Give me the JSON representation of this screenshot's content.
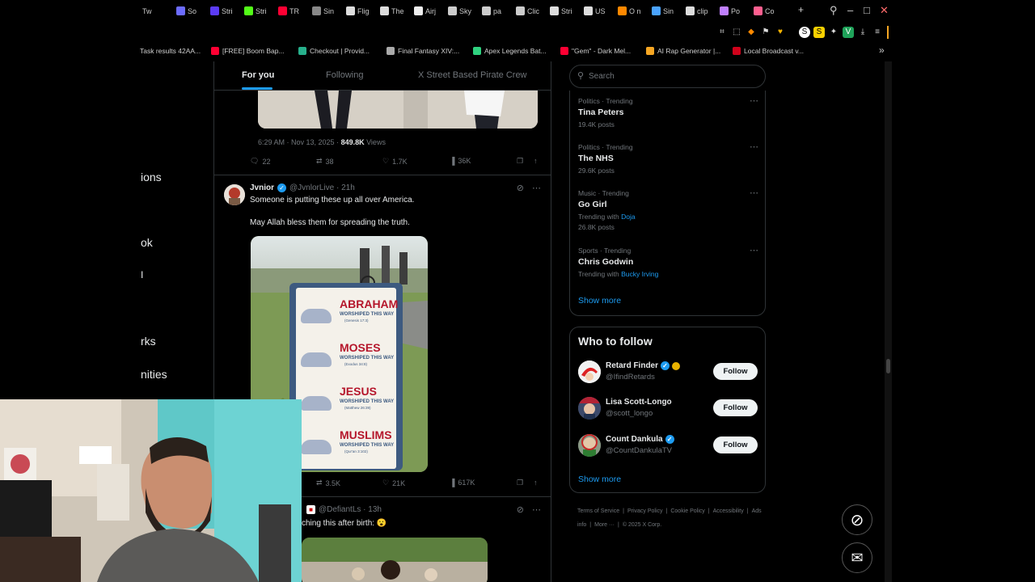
{
  "browser": {
    "tabs": [
      {
        "label": "Tw",
        "color": "#1da1f2"
      },
      {
        "label": "So",
        "color": "#6c6cff"
      },
      {
        "label": "Stri",
        "color": "#5b3bf5"
      },
      {
        "label": "Stri",
        "color": "#53fc18"
      },
      {
        "label": "TR",
        "color": "#ff0033"
      },
      {
        "label": "Sin",
        "color": "#888888"
      },
      {
        "label": "Flig",
        "color": "#dddddd"
      },
      {
        "label": "The",
        "color": "#dddddd"
      },
      {
        "label": "Airj",
        "color": "#eeeeee"
      },
      {
        "label": "Sky",
        "color": "#cccccc"
      },
      {
        "label": "pa",
        "color": "#cccccc"
      },
      {
        "label": "Clic",
        "color": "#cccccc"
      },
      {
        "label": "Stri",
        "color": "#dddddd"
      },
      {
        "label": "US",
        "color": "#dddddd"
      },
      {
        "label": "O n",
        "color": "#ff8800"
      },
      {
        "label": "Sin",
        "color": "#4aa3ff"
      },
      {
        "label": "clip",
        "color": "#dddddd"
      },
      {
        "label": "Po",
        "color": "#c080ff"
      },
      {
        "label": "Co",
        "color": "#ff5f8f"
      }
    ],
    "new_tab_symbol": "+",
    "bookmarks": [
      {
        "label": "Task results 42AA...",
        "color": "#333333"
      },
      {
        "label": "[FREE] Boom Bap...",
        "color": "#ff0033"
      },
      {
        "label": "Checkout | Provid...",
        "color": "#27b08c"
      },
      {
        "label": "Final Fantasy XIV:...",
        "color": "#aaaaaa"
      },
      {
        "label": "Apex Legends Bat...",
        "color": "#2fd17f"
      },
      {
        "label": "\"Gem\" - Dark Mel...",
        "color": "#ff0033"
      },
      {
        "label": "AI Rap Generator |...",
        "color": "#f5a623"
      },
      {
        "label": "Local Broadcast v...",
        "color": "#d0021b"
      }
    ]
  },
  "left_nav": [
    "ions",
    "ok",
    "I",
    "rks",
    "nities"
  ],
  "feed": {
    "tabs": [
      "For you",
      "Following",
      "X Street Based Pirate Crew"
    ],
    "prev_post": {
      "time": "6:29 AM · Nov 13, 2025 · ",
      "views_count": "849.8K",
      "views_label": " Views",
      "replies": "22",
      "reposts": "38",
      "likes": "1.7K",
      "analytics": "36K"
    },
    "post1": {
      "name": "Jvnior",
      "handle": "@JvnlorLive · 21h",
      "line1": "Someone is putting these up all over America.",
      "line2": "May Allah bless them for spreading the truth.",
      "sign": {
        "rows": [
          {
            "title": "ABRAHAM",
            "sub": "WORSHIPED THIS WAY",
            "ref": "(Genesis 17:3)"
          },
          {
            "title": "MOSES",
            "sub": "WORSHIPED THIS WAY",
            "ref": "(Exodus 34:8)"
          },
          {
            "title": "JESUS",
            "sub": "WORSHIPED THIS WAY",
            "ref": "(Matthew 26:39)"
          },
          {
            "title": "MUSLIMS",
            "sub": "WORSHIPED THIS WAY",
            "ref": "(Qur'an 3:102)"
          }
        ]
      },
      "reposts": "3.5K",
      "likes": "21K",
      "analytics": "617K"
    },
    "post2": {
      "handle": "@DefiantLs · 13h",
      "text": "ching this after birth: 😮"
    }
  },
  "sidebar": {
    "search_placeholder": "Search",
    "trends": [
      {
        "category": "Politics · Trending",
        "title": "Tina Peters",
        "sub": "19.4K posts",
        "with_label": "",
        "with_link": ""
      },
      {
        "category": "Politics · Trending",
        "title": "The NHS",
        "sub": "29.6K posts",
        "with_label": "",
        "with_link": ""
      },
      {
        "category": "Music · Trending",
        "title": "Go Girl",
        "sub": "26.8K posts",
        "with_label": "Trending with ",
        "with_link": "Doja"
      },
      {
        "category": "Sports · Trending",
        "title": "Chris Godwin",
        "sub": "",
        "with_label": "Trending with ",
        "with_link": "Bucky Irving"
      }
    ],
    "show_more": "Show more",
    "who_to_follow": {
      "title": "Who to follow",
      "users": [
        {
          "name": "Retard Finder",
          "handle": "@IfindRetards",
          "button": "Follow"
        },
        {
          "name": "Lisa Scott-Longo",
          "handle": "@scott_longo",
          "button": "Follow"
        },
        {
          "name": "Count Dankula",
          "handle": "@CountDankulaTV",
          "button": "Follow"
        }
      ],
      "show_more": "Show more"
    },
    "footer": {
      "links": [
        "Terms of Service",
        "|",
        "Privacy Policy",
        "|",
        "Cookie Policy",
        "|",
        "Accessibility",
        "|",
        "Ads info",
        "|",
        "More ···",
        "|",
        "© 2025 X Corp."
      ]
    }
  }
}
